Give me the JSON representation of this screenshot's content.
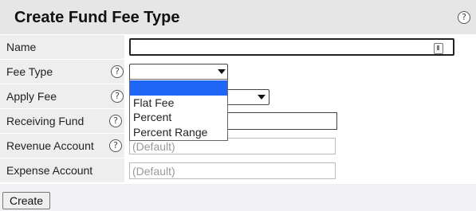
{
  "header": {
    "title": "Create Fund Fee Type"
  },
  "fields": [
    {
      "label": "Name",
      "value": ""
    },
    {
      "label": "Fee Type"
    },
    {
      "label": "Apply Fee"
    },
    {
      "label": "Receiving Fund",
      "value": ""
    },
    {
      "label": "Revenue Account",
      "placeholder": "(Default)"
    },
    {
      "label": "Expense Account",
      "placeholder": "(Default)"
    }
  ],
  "fee_type_dropdown": {
    "selected": "",
    "options": [
      "",
      "Flat Fee",
      "Percent",
      "Percent Range"
    ]
  },
  "help_glyph": "?",
  "create_label": "Create",
  "colors": {
    "header_bg": "#e6e6e6",
    "label_bg": "#eeeeee",
    "selected_option": "#1e66f5"
  }
}
